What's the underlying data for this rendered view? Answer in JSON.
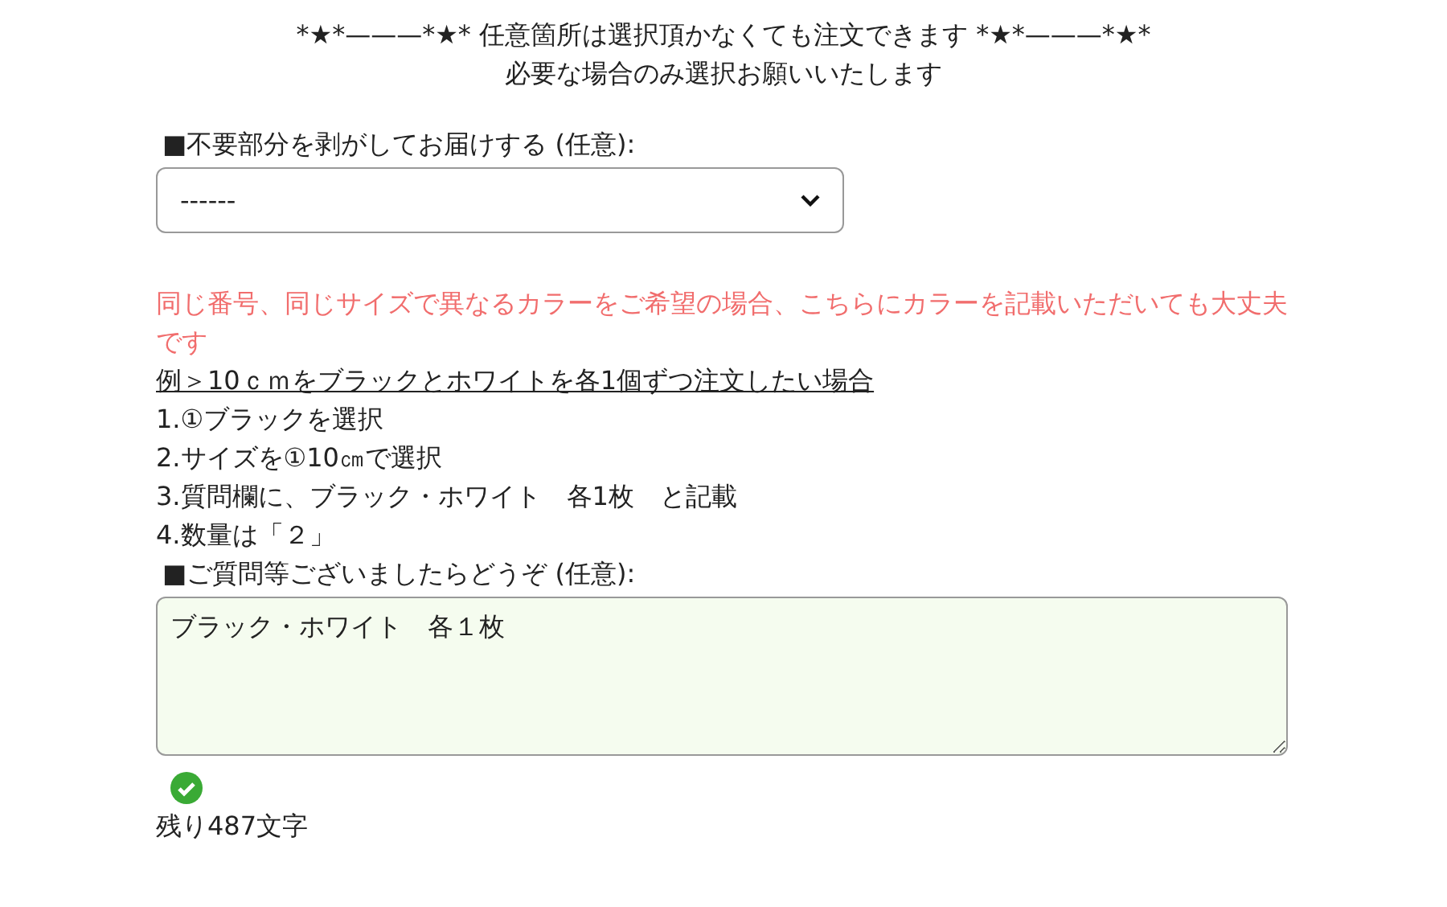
{
  "header": {
    "line_1": "*★*———*★* 任意箇所は選択頂かなくても注文できます *★*———*★*",
    "line_2": "必要な場合のみ選択お願いいたします"
  },
  "peel_option": {
    "label": "■不要部分を剥がしてお届けする (任意):",
    "value": "------"
  },
  "notice": "同じ番号、同じサイズで異なるカラーをご希望の場合、こちらにカラーを記載いただいても大丈夫です",
  "example_title": "例＞10ｃｍをブラックとホワイトを各1個ずつ注文したい場合",
  "steps": [
    "1.①ブラックを選択",
    "2.サイズを①10㎝で選択",
    "3.質問欄に、ブラック・ホワイト　各1枚　と記載",
    "4.数量は「２」"
  ],
  "question": {
    "label": "■ご質問等ございましたらどうぞ (任意):",
    "value": "ブラック・ホワイト　各１枚",
    "valid": true,
    "remaining": "残り487文字"
  }
}
